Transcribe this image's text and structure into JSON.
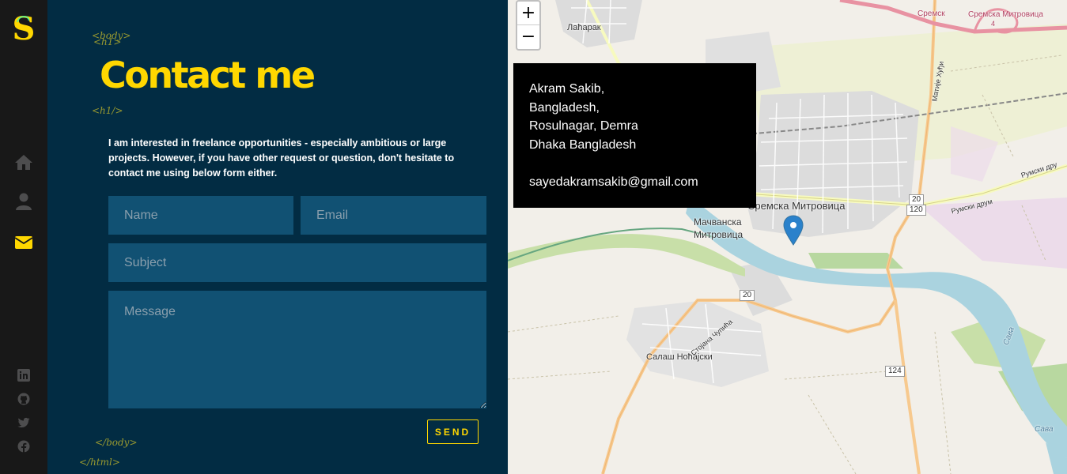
{
  "sidebar": {
    "logo_letter": "S",
    "nav": [
      {
        "name": "home",
        "icon": "home-icon"
      },
      {
        "name": "about",
        "icon": "user-icon"
      },
      {
        "name": "contact",
        "icon": "envelope-icon"
      }
    ],
    "social": [
      "linkedin-icon",
      "github-icon",
      "twitter-icon",
      "facebook-icon"
    ],
    "active_color": "#ffd700",
    "icon_color": "#4d4d4e"
  },
  "tags": {
    "body_open": "<body>",
    "h1_open": "<h1>",
    "h1_close": "<h1/>",
    "body_close": "</body>",
    "html_close": "</html>"
  },
  "contact": {
    "title": "Contact me",
    "intro": "I am interested in freelance opportunities - especially ambitious or large projects. However, if you have other request or question, don't hesitate to contact me using below form either.",
    "form": {
      "name_placeholder": "Name",
      "email_placeholder": "Email",
      "subject_placeholder": "Subject",
      "message_placeholder": "Message",
      "send_label": "SEND"
    }
  },
  "map": {
    "zoom_in": "+",
    "zoom_out": "−",
    "info": {
      "line1": "Akram Sakib,",
      "line2": "Bangladesh,",
      "line3": "Rosulnagar, Demra",
      "line4": "Dhaka Bangladesh",
      "email": "sayedakramsakib@gmail.com"
    },
    "labels": {
      "city": "Сремска Митровица",
      "macvanska1": "Мачванска",
      "macvanska2": "Митровица",
      "salas": "Салаш Ноћајски",
      "lacarak": "Лаћарак",
      "sremska_top": "Сремска Митровица",
      "sremska_top_num": "4",
      "sremsk": "Сремск",
      "rumski1": "Румски друм",
      "rumski2": "Румски дру",
      "matije": "Матије Хуђи",
      "stojana": "Стојана Чупића",
      "sava1": "Сава",
      "sava2": "Сава"
    },
    "shields": {
      "s20a": "20",
      "s120": "120",
      "s20b": "20",
      "s124": "124"
    }
  }
}
